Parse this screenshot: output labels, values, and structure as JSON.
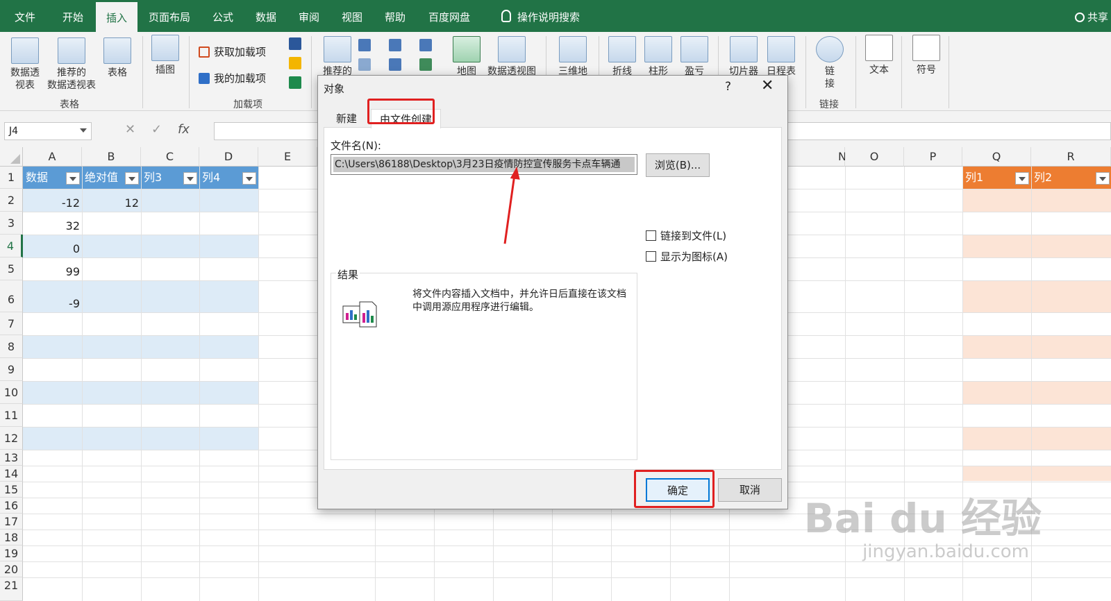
{
  "tabs": [
    "文件",
    "开始",
    "插入",
    "页面布局",
    "公式",
    "数据",
    "审阅",
    "视图",
    "帮助",
    "百度网盘",
    "操作说明搜索"
  ],
  "active_tab": "插入",
  "share_label": "共享",
  "ribbon": {
    "pivot1": "数据透\n视表",
    "pivot2": "推荐的\n数据透视表",
    "table": "表格",
    "group_tables": "表格",
    "illustrations": "插图",
    "get_addins": "获取加载项",
    "my_addins": "我的加载项",
    "group_addins": "加载项",
    "recommended_charts": "推荐的",
    "map": "地图",
    "pivot_chart": "数据透视图",
    "threed": "三维地",
    "line": "折线",
    "column": "柱形",
    "winloss": "盈亏",
    "slicer": "切片器",
    "timeline": "日程表",
    "link": "链\n接",
    "group_link": "链接",
    "text": "文本",
    "symbol": "符号"
  },
  "formula_bar": {
    "name_box": "J4",
    "fx": "fx"
  },
  "columns": [
    "A",
    "B",
    "C",
    "D",
    "E",
    "N",
    "O",
    "P",
    "Q",
    "R"
  ],
  "rows": [
    "1",
    "2",
    "3",
    "4",
    "5",
    "6",
    "7",
    "8",
    "9",
    "10",
    "11",
    "12",
    "13",
    "14",
    "15",
    "16",
    "17",
    "18",
    "19",
    "20",
    "21"
  ],
  "table1_headers": [
    "数据",
    "绝对值",
    "列3",
    "列4"
  ],
  "table2_headers": [
    "列1",
    "列2"
  ],
  "cells": {
    "A2": "-12",
    "B2": "12",
    "A3": "32",
    "A4": "0",
    "A5": "99",
    "A6": "-9"
  },
  "dialog": {
    "title": "对象",
    "help": "?",
    "tab_new": "新建",
    "tab_from_file": "由文件创建",
    "filename_label": "文件名(N):",
    "filename_value": "C:\\Users\\86188\\Desktop\\3月23日疫情防控宣传服务卡点车辆通",
    "browse": "浏览(B)...",
    "link_to_file": "链接到文件(L)",
    "display_as_icon": "显示为图标(A)",
    "result_label": "结果",
    "result_text": "将文件内容插入文档中，并允许日后直接在该文档中调用源应用程序进行编辑。",
    "ok": "确定",
    "cancel": "取消"
  },
  "watermark": {
    "brand": "Bai du 经验",
    "url": "jingyan.baidu.com"
  },
  "colors": {
    "excel_green": "#217346",
    "table_blue": "#5b9bd5",
    "table_band": "#ddebf7",
    "table_orange": "#ed7d31",
    "orange_band": "#fce4d6",
    "highlight_red": "#e02020"
  }
}
